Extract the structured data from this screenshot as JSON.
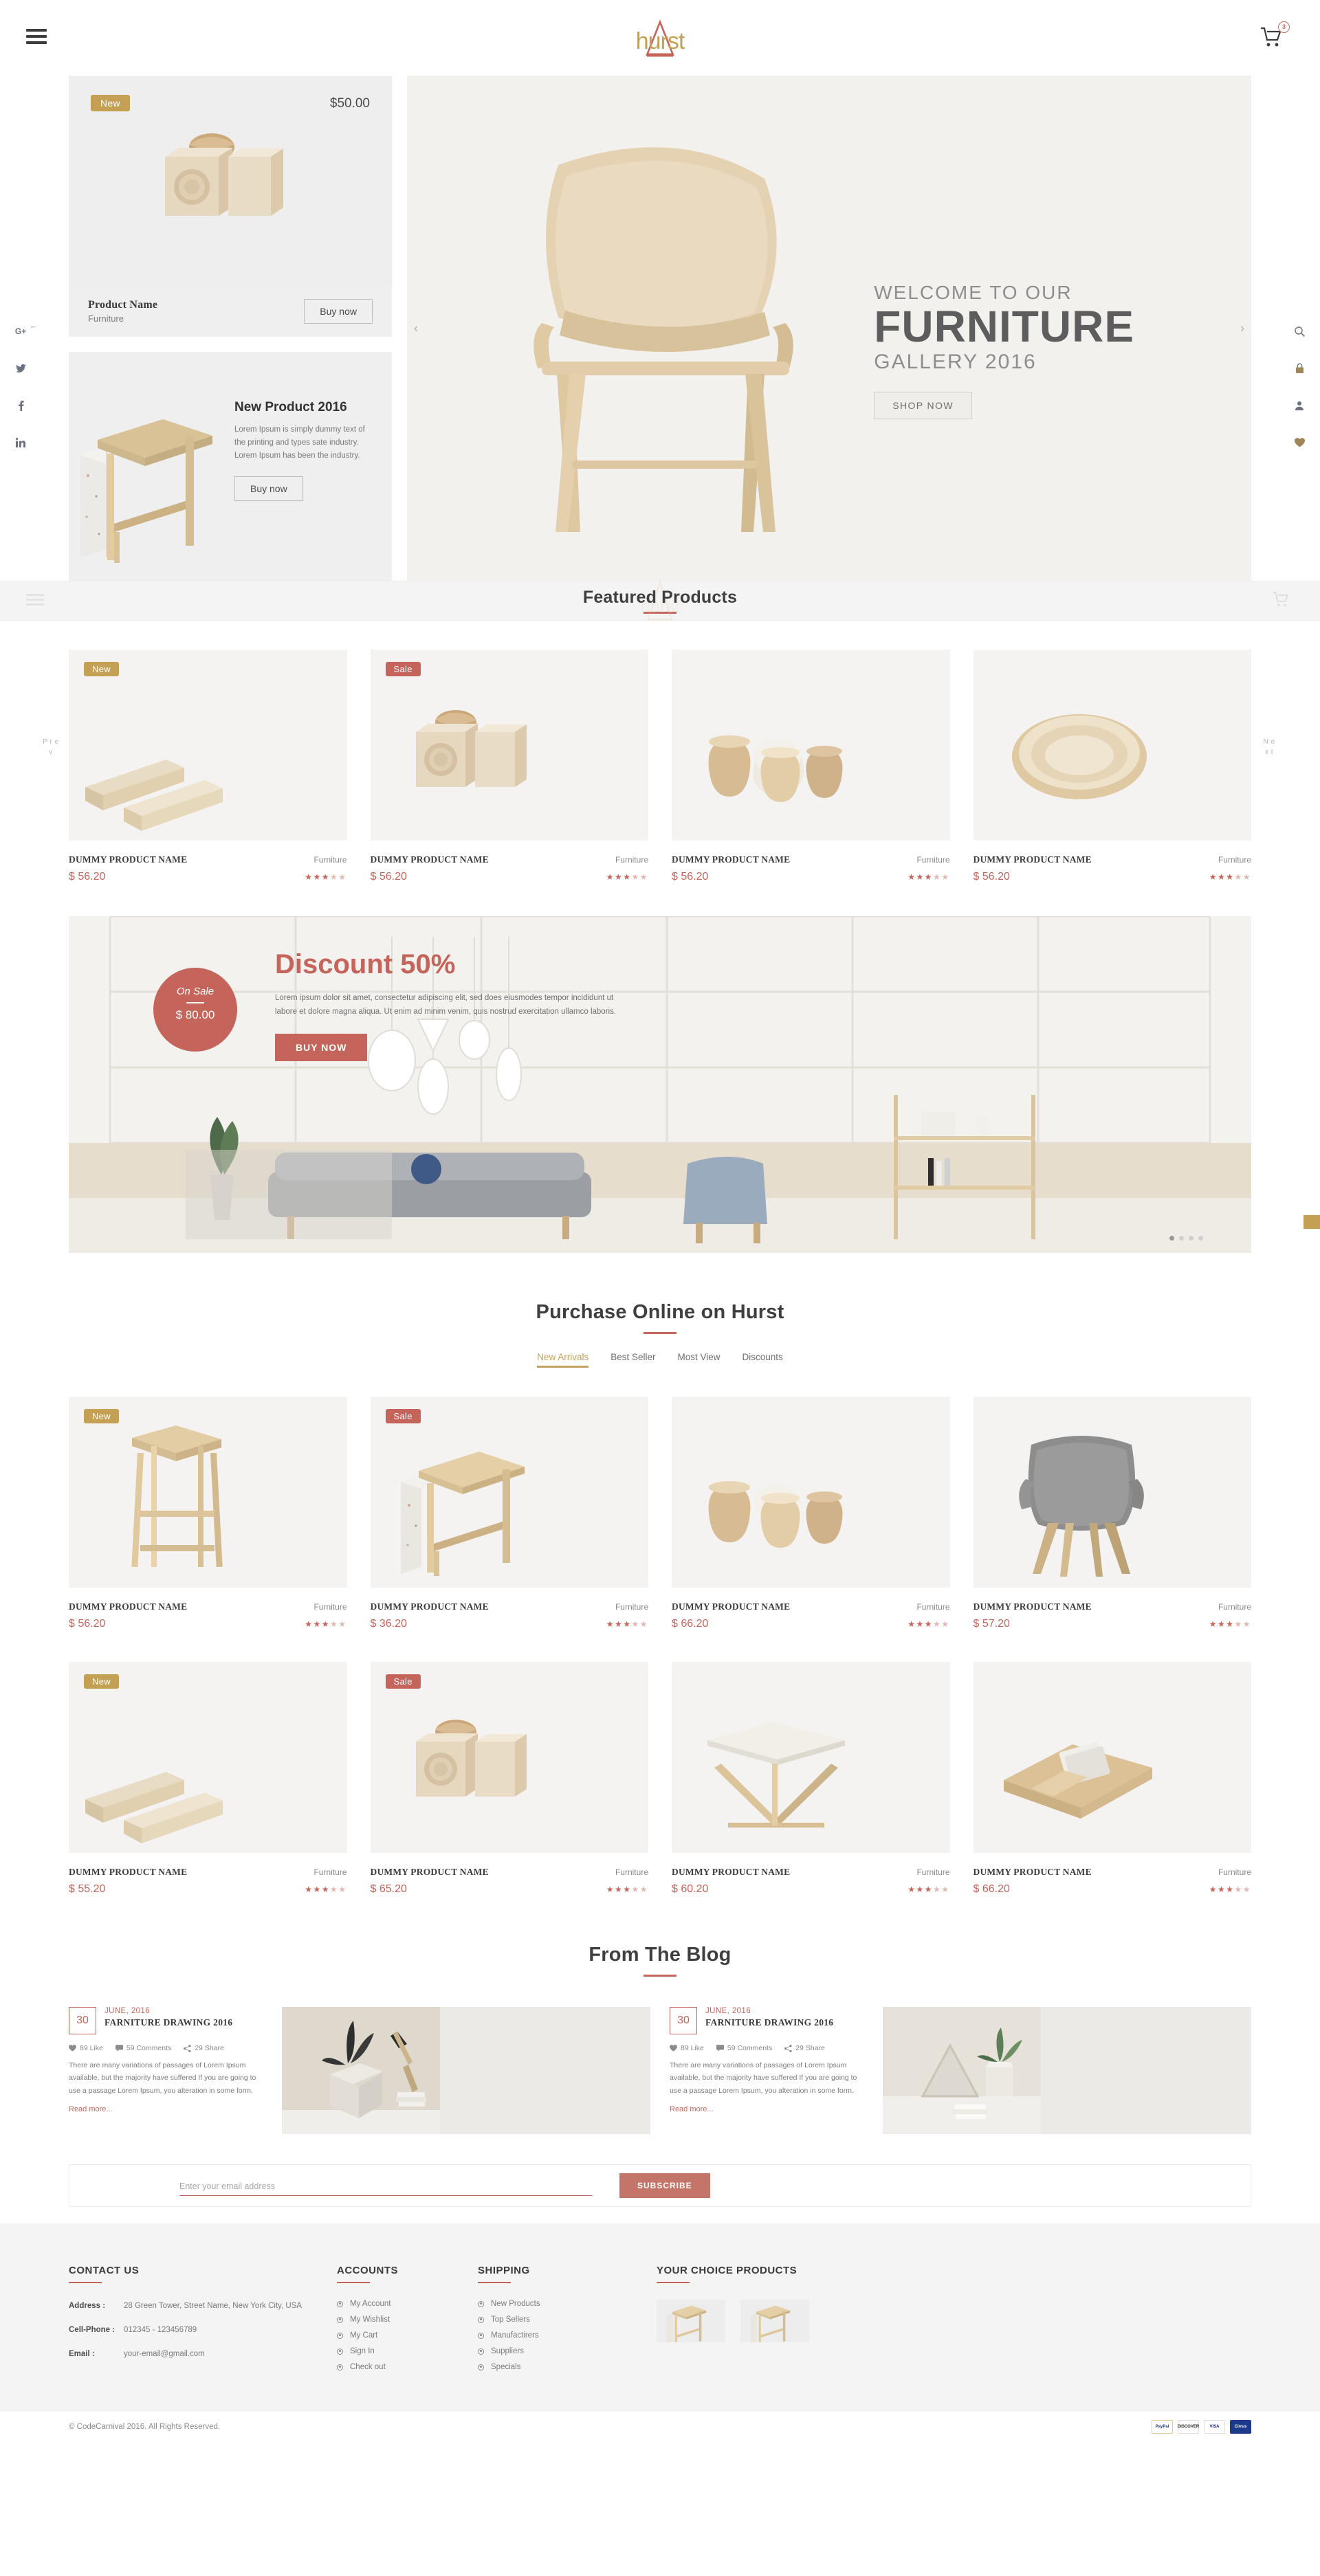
{
  "brand": {
    "name": "hurst",
    "accent": "#c4645b",
    "gold": "#c4a055"
  },
  "header": {
    "menu_icon": "hamburger-icon",
    "cart_icon": "cart-icon",
    "cart_count": "3"
  },
  "social_rail": [
    {
      "name": "googleplus",
      "label": "G+"
    },
    {
      "name": "twitter",
      "label": "t"
    },
    {
      "name": "facebook",
      "label": "f"
    },
    {
      "name": "linkedin",
      "label": "in"
    }
  ],
  "tools_rail": [
    {
      "name": "search-icon"
    },
    {
      "name": "lock-icon"
    },
    {
      "name": "user-icon"
    },
    {
      "name": "heart-icon"
    }
  ],
  "hero": {
    "welcome": "WELCOME TO OUR",
    "title": "FURNITURE",
    "subtitle": "GALLERY 2016",
    "cta": "SHOP NOW",
    "prev": "‹",
    "next": "›"
  },
  "promo_card": {
    "badge": "New",
    "price": "$50.00",
    "name": "Product Name",
    "category": "Furniture",
    "button": "Buy now"
  },
  "promo_card2": {
    "title": "New Product 2016",
    "body": "Lorem Ipsum is simply dummy text of the printing and types sate industry. Lorem Ipsum has been the industry.",
    "button": "Buy now"
  },
  "featured": {
    "title": "Featured Products",
    "prev_label": "P r e v",
    "next_label": "N e x t",
    "products": [
      {
        "badge": "New",
        "badge_type": "new",
        "name": "DUMMY PRODUCT NAME",
        "category": "Furniture",
        "price": "$ 56.20",
        "rating": 3.5,
        "image": "wood-tray"
      },
      {
        "badge": "Sale",
        "badge_type": "sale",
        "name": "DUMMY PRODUCT NAME",
        "category": "Furniture",
        "price": "$ 56.20",
        "rating": 3.5,
        "image": "wood-cubes"
      },
      {
        "badge": "",
        "badge_type": "",
        "name": "DUMMY PRODUCT NAME",
        "category": "Furniture",
        "price": "$ 56.20",
        "rating": 3.5,
        "image": "wood-cups"
      },
      {
        "badge": "",
        "badge_type": "",
        "name": "DUMMY PRODUCT NAME",
        "category": "Furniture",
        "price": "$ 56.20",
        "rating": 3.5,
        "image": "wood-bowl"
      }
    ]
  },
  "discount": {
    "on_sale_label": "On Sale",
    "on_sale_price": "$ 80.00",
    "title": "Discount 50%",
    "body": "Lorem ipsum dolor sit amet, consectetur adipiscing elit, sed does eiusmodes tempor incididunt ut labore et dolore magna aliqua. Ut enim ad minim venim, quis nostrud exercitation ullamco laboris.",
    "button": "BUY NOW",
    "active_dot": 1,
    "dot_count": 4
  },
  "purchase": {
    "title": "Purchase Online on Hurst",
    "tabs": [
      {
        "label": "New Arrivals",
        "active": true
      },
      {
        "label": "Best Seller",
        "active": false
      },
      {
        "label": "Most View",
        "active": false
      },
      {
        "label": "Discounts",
        "active": false
      }
    ],
    "row1": [
      {
        "badge": "New",
        "badge_type": "new",
        "name": "DUMMY PRODUCT NAME",
        "category": "Furniture",
        "price": "$ 56.20",
        "rating": 3.5,
        "image": "wood-stool-tall"
      },
      {
        "badge": "Sale",
        "badge_type": "sale",
        "name": "DUMMY PRODUCT NAME",
        "category": "Furniture",
        "price": "$ 36.20",
        "rating": 3.5,
        "image": "wood-side-table"
      },
      {
        "badge": "",
        "badge_type": "",
        "name": "DUMMY PRODUCT NAME",
        "category": "Furniture",
        "price": "$ 66.20",
        "rating": 3.5,
        "image": "wood-cups"
      },
      {
        "badge": "",
        "badge_type": "",
        "name": "DUMMY PRODUCT NAME",
        "category": "Furniture",
        "price": "$ 57.20",
        "rating": 3.5,
        "image": "grey-chair"
      }
    ],
    "row2": [
      {
        "badge": "New",
        "badge_type": "new",
        "name": "DUMMY PRODUCT NAME",
        "category": "Furniture",
        "price": "$ 55.20",
        "rating": 3.5,
        "image": "wood-tray"
      },
      {
        "badge": "Sale",
        "badge_type": "sale",
        "name": "DUMMY PRODUCT NAME",
        "category": "Furniture",
        "price": "$ 65.20",
        "rating": 3.5,
        "image": "wood-cubes"
      },
      {
        "badge": "",
        "badge_type": "",
        "name": "DUMMY PRODUCT NAME",
        "category": "Furniture",
        "price": "$ 60.20",
        "rating": 3.5,
        "image": "folding-table"
      },
      {
        "badge": "",
        "badge_type": "",
        "name": "DUMMY PRODUCT NAME",
        "category": "Furniture",
        "price": "$ 66.20",
        "rating": 3.5,
        "image": "wood-tray-books"
      }
    ]
  },
  "blog": {
    "title": "From The Blog",
    "posts": [
      {
        "day": "30",
        "date": "JUNE, 2016",
        "title": "FARNITURE DRAWING 2016",
        "likes": "89 Like",
        "comments": "59 Comments",
        "shares": "29 Share",
        "body": "There are many variations of passages of Lorem Ipsum available, but the majority have suffered If you are going to use a passage Lorem Ipsum, you alteration in some form.",
        "read_more": "Read more...",
        "image": "plant-lamp-desk"
      },
      {
        "day": "30",
        "date": "JUNE, 2016",
        "title": "FARNITURE DRAWING 2016",
        "likes": "89 Like",
        "comments": "59 Comments",
        "shares": "29 Share",
        "body": "There are many variations of passages of Lorem Ipsum available, but the majority have suffered If you are going to use a passage Lorem Ipsum, you alteration in some form.",
        "read_more": "Read more...",
        "image": "plant-books-triangle"
      }
    ]
  },
  "newsletter": {
    "placeholder": "Enter your email address",
    "value": "",
    "button": "SUBSCRIBE"
  },
  "footer": {
    "contact": {
      "heading": "CONTACT US",
      "address_label": "Address :",
      "address_value": "28 Green Tower, Street Name, New York City, USA",
      "phone_label": "Cell-Phone :",
      "phone_value": "012345 - 123456789",
      "email_label": "Email :",
      "email_value": "your-email@gmail.com"
    },
    "accounts": {
      "heading": "ACCOUNTS",
      "items": [
        "My Account",
        "My Wishlist",
        "My Cart",
        "Sign In",
        "Check out"
      ]
    },
    "shipping": {
      "heading": "SHIPPING",
      "items": [
        "New Products",
        "Top Sellers",
        "Manufactirers",
        "Suppliers",
        "Specials"
      ]
    },
    "choice": {
      "heading": "YOUR CHOICE PRODUCTS",
      "thumbs": [
        "wood-side-table",
        "wood-side-table"
      ]
    }
  },
  "bottom": {
    "copyright": "© CodeCarnival 2016. All Rights Reserved.",
    "payments": [
      {
        "name": "paypal",
        "label": "PayPal"
      },
      {
        "name": "discover",
        "label": "DISCOVER"
      },
      {
        "name": "visa",
        "label": "VISA"
      },
      {
        "name": "cirrus",
        "label": "Cirrus"
      }
    ]
  }
}
